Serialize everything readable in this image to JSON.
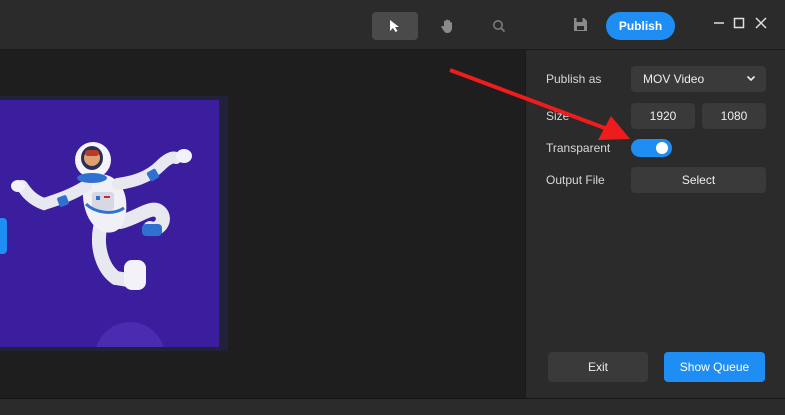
{
  "toolbar": {
    "tools": [
      {
        "name": "select-tool",
        "icon": "cursor-icon",
        "active": true
      },
      {
        "name": "pan-tool",
        "icon": "hand-icon",
        "active": false
      },
      {
        "name": "zoom-tool",
        "icon": "search-icon",
        "active": false
      }
    ],
    "save_icon": "save-icon",
    "publish_label": "Publish",
    "window_controls": [
      "minimize-icon",
      "maximize-icon",
      "close-icon"
    ]
  },
  "panel": {
    "publish_as_label": "Publish as",
    "publish_as_value": "MOV Video",
    "size_label": "Size",
    "width": "1920",
    "height": "1080",
    "transparent_label": "Transparent",
    "transparent_on": true,
    "output_label": "Output File",
    "output_button": "Select",
    "exit_label": "Exit",
    "show_queue_label": "Show Queue"
  },
  "colors": {
    "accent": "#1e8ef5",
    "background": "#2b2b2b",
    "canvas_frame": "#3a1e9e",
    "annotation_arrow": "#ee1c1c"
  }
}
